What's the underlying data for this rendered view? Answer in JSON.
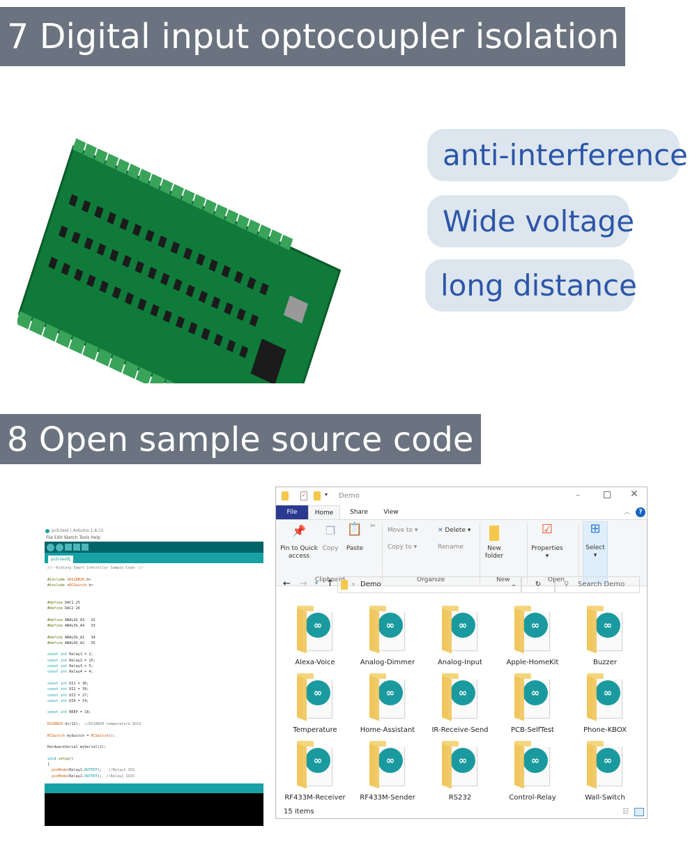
{
  "section7": {
    "title": "7 Digital input optocoupler isolation",
    "features": [
      "anti-interference",
      "Wide voltage",
      "long distance"
    ]
  },
  "section8": {
    "title": "8 Open sample source code"
  },
  "arduino": {
    "window_title": "pcb-test | Arduino 1.8.15",
    "menu": "File  Edit  Sketch  Tools  Help",
    "tab": "pcb-test§",
    "code": [
      [
        [
          "//--KinCony Smart Controller Sample Code--//",
          "c"
        ]
      ],
      [],
      [
        [
          "#include ",
          "g"
        ],
        [
          "<",
          ""
        ],
        [
          "DS18B20",
          "o"
        ],
        [
          ".h>",
          ""
        ]
      ],
      [
        [
          "#include ",
          "g"
        ],
        [
          "<",
          ""
        ],
        [
          "RCSwitch",
          "o"
        ],
        [
          ".h>",
          ""
        ]
      ],
      [],
      [],
      [
        [
          "#define ",
          "g"
        ],
        [
          "DAC1 25",
          ""
        ]
      ],
      [
        [
          "#define ",
          "g"
        ],
        [
          "DAC2 26",
          ""
        ]
      ],
      [],
      [
        [
          "#define ",
          "g"
        ],
        [
          "ANALOG_A3   32",
          ""
        ]
      ],
      [
        [
          "#define ",
          "g"
        ],
        [
          "ANALOG_A4   33",
          ""
        ]
      ],
      [],
      [
        [
          "#define ",
          "g"
        ],
        [
          "ANALOG_A1   34",
          ""
        ]
      ],
      [
        [
          "#define ",
          "g"
        ],
        [
          "ANALOG_A2   35",
          ""
        ]
      ],
      [],
      [
        [
          "const int ",
          "k"
        ],
        [
          "Relay1 = 2;",
          ""
        ]
      ],
      [
        [
          "const int ",
          "k"
        ],
        [
          "Relay2 = 15;",
          ""
        ]
      ],
      [
        [
          "const int ",
          "k"
        ],
        [
          "Relay3 = 5;",
          ""
        ]
      ],
      [
        [
          "const int ",
          "k"
        ],
        [
          "Relay4 = 4;",
          ""
        ]
      ],
      [],
      [
        [
          "const int ",
          "k"
        ],
        [
          "DI1 = 36;",
          ""
        ]
      ],
      [
        [
          "const int ",
          "k"
        ],
        [
          "DI2 = 39;",
          ""
        ]
      ],
      [
        [
          "const int ",
          "k"
        ],
        [
          "DI3 = 27;",
          ""
        ]
      ],
      [
        [
          "const int ",
          "k"
        ],
        [
          "DI4 = 14;",
          ""
        ]
      ],
      [],
      [
        [
          "const int ",
          "k"
        ],
        [
          "BEEP = 18;",
          ""
        ]
      ],
      [],
      [
        [
          "DS18B20",
          "o"
        ],
        [
          " ds(13);  ",
          ""
        ],
        [
          "//DS18B20 temperature IO13",
          "c"
        ]
      ],
      [],
      [
        [
          "RCSwitch",
          "o"
        ],
        [
          " mySwitch = ",
          ""
        ],
        [
          "RCSwitch",
          "o"
        ],
        [
          "();",
          ""
        ]
      ],
      [],
      [
        [
          "HardwareSerial mySerial(2);",
          ""
        ]
      ],
      [],
      [
        [
          "void ",
          "k"
        ],
        [
          "setup",
          "g"
        ],
        [
          "()",
          ""
        ]
      ],
      [
        [
          "{",
          ""
        ]
      ],
      [
        [
          "  pinMode",
          "o"
        ],
        [
          "(Relay1,",
          ""
        ],
        [
          "OUTPUT",
          "k"
        ],
        [
          ");   ",
          ""
        ],
        [
          "//Relay1 IO2",
          "c"
        ]
      ],
      [
        [
          "  pinMode",
          "o"
        ],
        [
          "(Relay2,",
          ""
        ],
        [
          "OUTPUT",
          "k"
        ],
        [
          ");  ",
          ""
        ],
        [
          "//Relay2 IO15",
          "c"
        ]
      ]
    ]
  },
  "explorer": {
    "title": "Demo",
    "tabs": [
      "File",
      "Home",
      "Share",
      "View"
    ],
    "ribbon": {
      "pin": "Pin to Quick access",
      "copy": "Copy",
      "paste": "Paste",
      "move_to": "Move to",
      "copy_to": "Copy to",
      "delete": "Delete",
      "rename": "Rename",
      "new_folder": "New folder",
      "properties": "Properties",
      "select": "Select",
      "groups": [
        "Clipboard",
        "Organize",
        "New",
        "Open"
      ]
    },
    "address": "Demo",
    "search_placeholder": "Search Demo",
    "folders": [
      "Alexa-Voice",
      "Analog-Dimmer",
      "Analog-Input",
      "Apple-HomeKit",
      "Buzzer",
      "Temperature",
      "Home-Assistant",
      "IR-Receive-Send",
      "PCB-SelfTest",
      "Phone-KBOX",
      "RF433M-Receiver",
      "RF433M-Sender",
      "RS232",
      "Control-Relay",
      "Wall-Switch"
    ],
    "status": "15 items",
    "colors": {
      "file_tab": "#2b3990",
      "help": "#1565c0"
    }
  }
}
